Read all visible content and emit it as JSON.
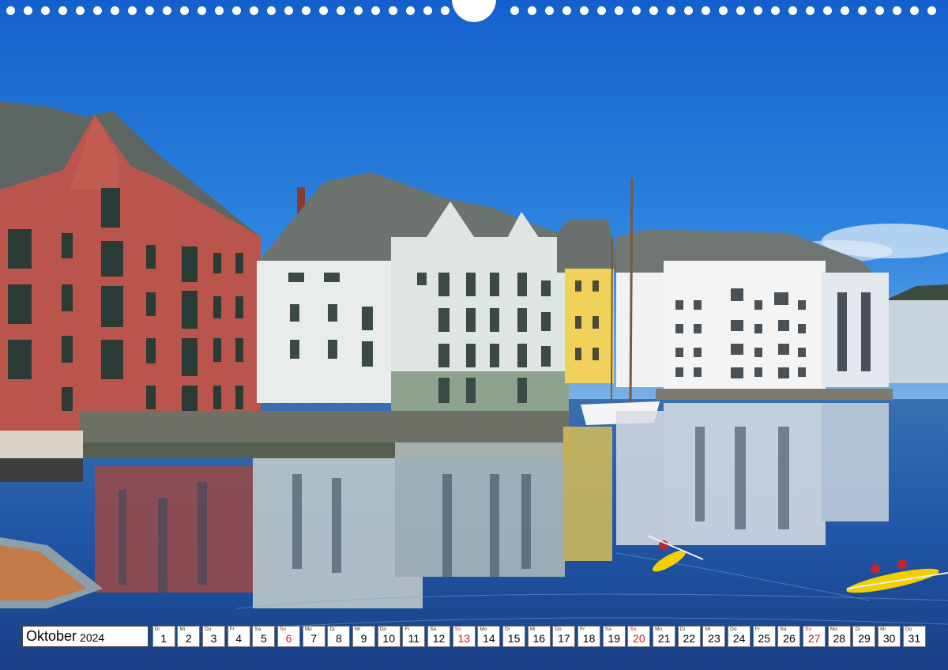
{
  "calendar": {
    "month": "Oktober",
    "year": "2024",
    "sunday_color": "#d0201a",
    "days": [
      {
        "weekday": "Di",
        "day": "1"
      },
      {
        "weekday": "Mi",
        "day": "2"
      },
      {
        "weekday": "Do",
        "day": "3"
      },
      {
        "weekday": "Fr",
        "day": "4"
      },
      {
        "weekday": "Sa",
        "day": "5"
      },
      {
        "weekday": "So",
        "day": "6"
      },
      {
        "weekday": "Mo",
        "day": "7"
      },
      {
        "weekday": "Di",
        "day": "8"
      },
      {
        "weekday": "Mi",
        "day": "9"
      },
      {
        "weekday": "Do",
        "day": "10"
      },
      {
        "weekday": "Fr",
        "day": "11"
      },
      {
        "weekday": "Sa",
        "day": "12"
      },
      {
        "weekday": "So",
        "day": "13"
      },
      {
        "weekday": "Mo",
        "day": "14"
      },
      {
        "weekday": "Di",
        "day": "15"
      },
      {
        "weekday": "Mi",
        "day": "16"
      },
      {
        "weekday": "Do",
        "day": "17"
      },
      {
        "weekday": "Fr",
        "day": "18"
      },
      {
        "weekday": "Sa",
        "day": "19"
      },
      {
        "weekday": "So",
        "day": "20"
      },
      {
        "weekday": "Mo",
        "day": "21"
      },
      {
        "weekday": "Di",
        "day": "22"
      },
      {
        "weekday": "Mi",
        "day": "23"
      },
      {
        "weekday": "Do",
        "day": "24"
      },
      {
        "weekday": "Fr",
        "day": "25"
      },
      {
        "weekday": "Sa",
        "day": "26"
      },
      {
        "weekday": "So",
        "day": "27"
      },
      {
        "weekday": "Mo",
        "day": "28"
      },
      {
        "weekday": "Di",
        "day": "29"
      },
      {
        "weekday": "Mi",
        "day": "30"
      },
      {
        "weekday": "Do",
        "day": "31"
      }
    ]
  },
  "photo": {
    "sky_color": "#1e6fd0",
    "water_color": "#1d4fa0",
    "building_colors": [
      "#b9554a",
      "#e6ece6",
      "#f0d25a",
      "#f4f4f4"
    ],
    "kayak_color": "#f2d000"
  }
}
